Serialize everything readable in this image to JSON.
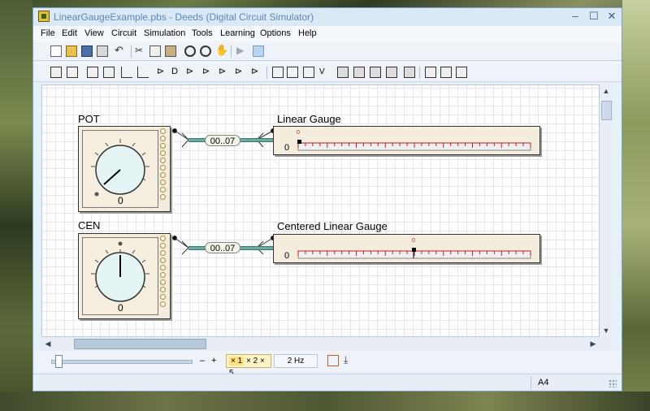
{
  "window": {
    "title": "LinearGaugeExample.pbs - Deeds (Digital Circuit Simulator)",
    "controls": [
      "–",
      "☐",
      "✕"
    ]
  },
  "menu": [
    "File",
    "Edit",
    "View",
    "Circuit",
    "Simulation",
    "Tools",
    "Learning",
    "Options",
    "Help"
  ],
  "toolbar1": [
    "new-icon",
    "open-icon",
    "save-icon",
    "print-icon",
    "undo-icon",
    "cut-icon",
    "copy-icon",
    "paste-icon",
    "zoom-in-icon",
    "zoom-out-icon",
    "pan-hand-icon",
    "run-icon",
    "stop-icon"
  ],
  "toolbar2": [
    "component-1-icon",
    "component-2-icon",
    "component-3-icon",
    "component-4-icon",
    "wire-icon",
    "gate-buffer-icon",
    "gate-and-icon",
    "gate-or-icon",
    "gate-xor-icon",
    "gate-not-icon",
    "gate-nand-icon",
    "gate-nor-icon",
    "flipflop-icon",
    "mux-icon",
    "demux-icon",
    "chip-1-icon",
    "chip-2-icon",
    "chip-3-icon",
    "chip-4-icon",
    "display-1-icon",
    "display-2-icon",
    "display-3-icon"
  ],
  "circuit": {
    "pot": {
      "label": "POT",
      "value": "0",
      "level": 0
    },
    "cen": {
      "label": "CEN",
      "value": "0",
      "level": 0.5
    },
    "bus1": {
      "label": "00..07"
    },
    "bus2": {
      "label": "00..07"
    },
    "gauge1": {
      "label": "Linear Gauge",
      "zero_label": "0",
      "marker_label": "0",
      "value": 0
    },
    "gauge2": {
      "label": "Centered Linear Gauge",
      "zero_label": "0",
      "marker_label": "0",
      "value": 0
    }
  },
  "simulation": {
    "speed_selected": "× 1",
    "speed_others": [
      "× 2",
      "× 5"
    ],
    "frequency": "2 Hz",
    "minus": "–",
    "plus": "+"
  },
  "status": {
    "page": "A4"
  },
  "colors": {
    "bus": "#6aaaa0",
    "gauge_tick": "#c02020",
    "component_bg": "#f4ecdc"
  }
}
